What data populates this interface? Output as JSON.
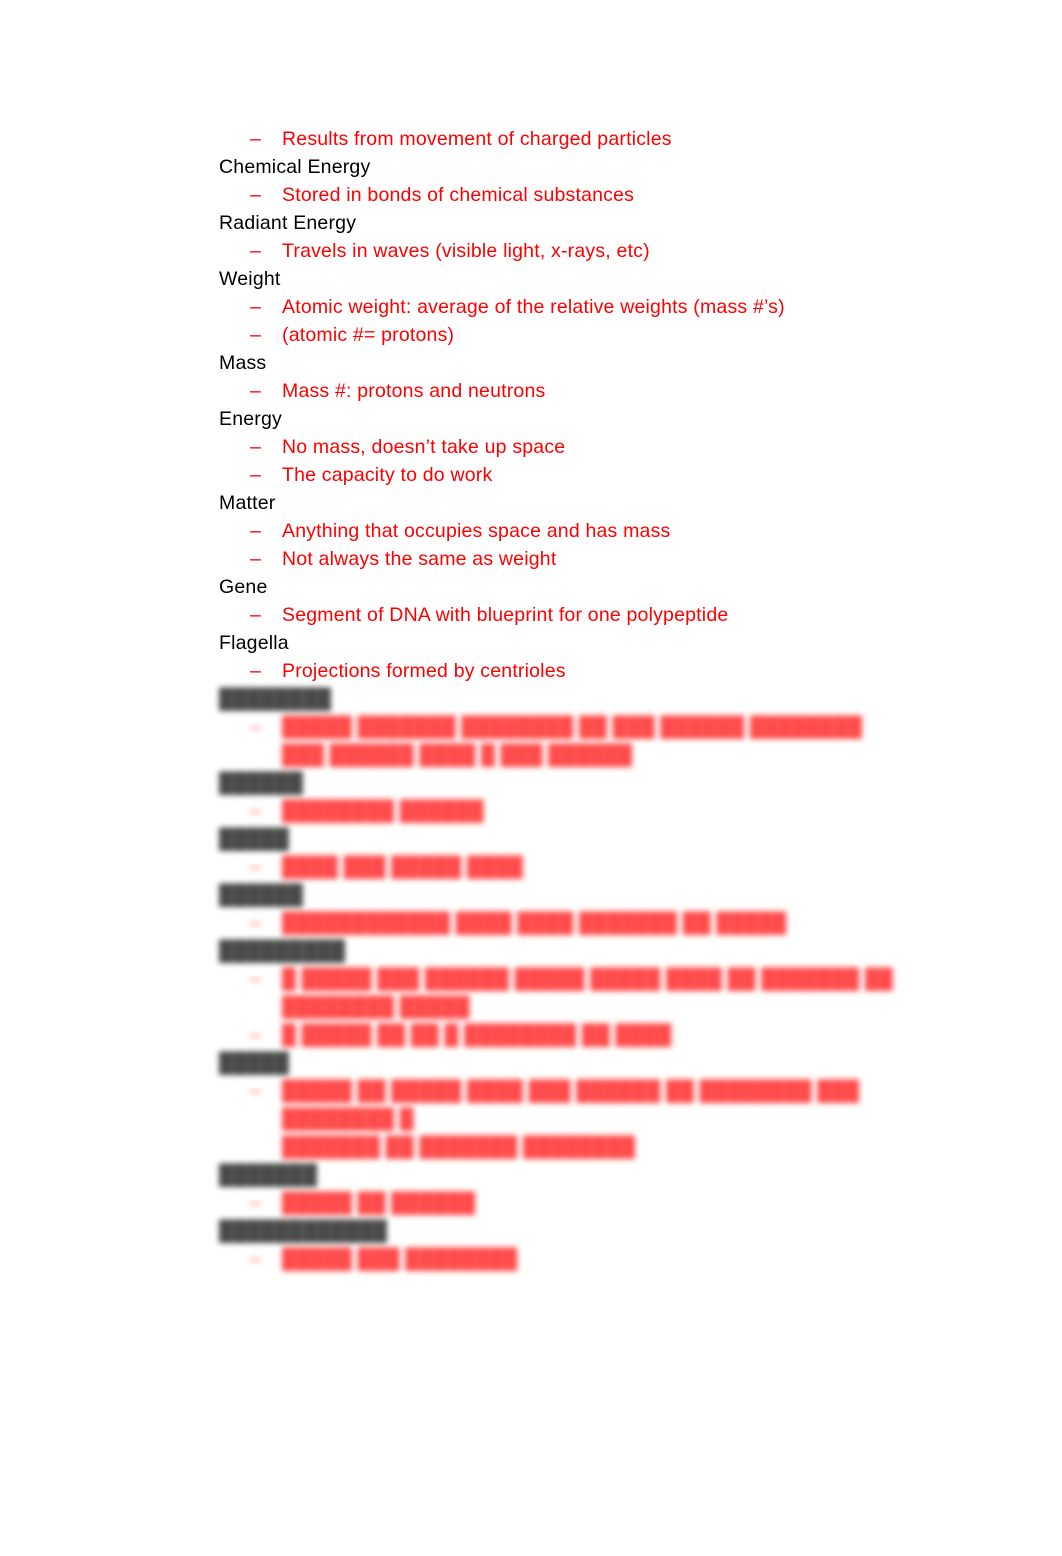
{
  "document": {
    "type": "study-notes-outline",
    "background_color": "#FFFFFF",
    "term_color": "#000000",
    "subitem_color": "#FF0000",
    "bullet_marker": "–"
  },
  "outline": {
    "sharp_section": [
      {
        "kind": "subitem",
        "marker": "–",
        "text": "Results from movement of charged particles"
      },
      {
        "kind": "term",
        "text": "Chemical Energy"
      },
      {
        "kind": "subitem",
        "marker": "–",
        "text": "Stored in bonds of chemical substances"
      },
      {
        "kind": "term",
        "text": "Radiant Energy"
      },
      {
        "kind": "subitem",
        "marker": "–",
        "text": "Travels in waves (visible light, x-rays, etc)"
      },
      {
        "kind": "term",
        "text": "Weight"
      },
      {
        "kind": "subitem",
        "marker": "–",
        "text": "Atomic weight: average of the relative weights (mass #’s)"
      },
      {
        "kind": "subitem",
        "marker": "–",
        "text": "(atomic #= protons)"
      },
      {
        "kind": "term",
        "text": "Mass"
      },
      {
        "kind": "subitem",
        "marker": "–",
        "text": "Mass #: protons and neutrons"
      },
      {
        "kind": "term",
        "text": "Energy"
      },
      {
        "kind": "subitem",
        "marker": "–",
        "text": "No mass, doesn’t take up space"
      },
      {
        "kind": "subitem",
        "marker": "–",
        "text": "The capacity to do work"
      },
      {
        "kind": "term",
        "text": "Matter"
      },
      {
        "kind": "subitem",
        "marker": "–",
        "text": "Anything that occupies space and has mass"
      },
      {
        "kind": "subitem",
        "marker": "–",
        "text": "Not always the same as weight"
      },
      {
        "kind": "term",
        "text": "Gene"
      },
      {
        "kind": "subitem",
        "marker": "–",
        "text": "Segment of DNA with blueprint for one polypeptide"
      },
      {
        "kind": "term",
        "text": "Flagella"
      },
      {
        "kind": "subitem",
        "marker": "–",
        "text": "Projections formed by centrioles"
      }
    ],
    "blurred_section_note": "Lower portion of the page is out of focus / blurred and its text is not legible in the screenshot.",
    "blurred_section": [
      {
        "kind": "term",
        "text": "████████"
      },
      {
        "kind": "subitem",
        "marker": "–",
        "text": "█████ ███████ ████████ ██ ███ ██████ ████████",
        "text_line2": "███ ██████ ████ █ ███ ██████"
      },
      {
        "kind": "term",
        "text": "██████"
      },
      {
        "kind": "subitem",
        "marker": "–",
        "text": "████████ ██████"
      },
      {
        "kind": "term",
        "text": "█████"
      },
      {
        "kind": "subitem",
        "marker": "–",
        "text": "████ ███ █████ ████"
      },
      {
        "kind": "term",
        "text": "██████"
      },
      {
        "kind": "subitem",
        "marker": "–",
        "text": "████████████ ████ ████ ███████ ██ █████"
      },
      {
        "kind": "term",
        "text": "█████████"
      },
      {
        "kind": "subitem",
        "marker": "–",
        "text": "█ █████ ███ ██████ █████ █████ ████ ██ ███████ ██",
        "text_line2": "████████ █████"
      },
      {
        "kind": "subitem",
        "marker": "–",
        "text": "█ █████ ██ ██ █ ████████ ██ ████"
      },
      {
        "kind": "term",
        "text": "█████"
      },
      {
        "kind": "subitem",
        "marker": "–",
        "text": "█████ ██ █████ ████ ███ ██████ ██ ████████ ███ ████████ █",
        "text_line2": "███████ ██ ███████ ████████"
      },
      {
        "kind": "term",
        "text": "███████"
      },
      {
        "kind": "subitem",
        "marker": "–",
        "text": "█████ ██ ██████"
      },
      {
        "kind": "term",
        "text": "████████████"
      },
      {
        "kind": "subitem",
        "marker": "–",
        "text": "█████ ███ ████████"
      }
    ]
  }
}
